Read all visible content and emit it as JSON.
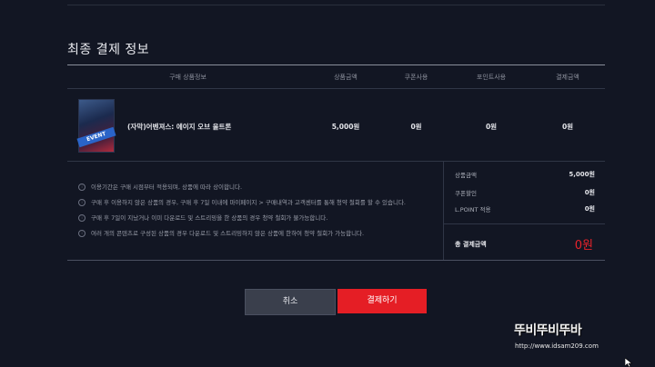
{
  "section": {
    "title": "최종 결제 정보"
  },
  "table": {
    "headers": [
      "구매 상품정보",
      "상품금액",
      "쿠폰사용",
      "포인트사용",
      "결제금액"
    ],
    "row": {
      "product_name": "(자막)어벤져스: 에이지 오브 울트론",
      "poster_badge": "EVENT",
      "price": "5,000원",
      "coupon": "0원",
      "points": "0원",
      "payment": "0원"
    }
  },
  "notes": [
    "이용기간은 구매 시점부터 적용되며, 상품에 따라 상이합니다.",
    "구매 후 이용하지 않은 상품의 경우, 구매 후 7일 이내에 마이페이지 > 구매내역과 고객센터를 통해 청약 철회를 할 수 있습니다.",
    "구매 후 7일이 지났거나 이미 다운로드 및 스트리밍을 한 상품의 경우 청약 철회가 불가능합니다.",
    "여러 개의 콘텐츠로 구성된 상품의 경우 다운로드 및 스트리밍하지 않은 상품에 한하여 청약 철회가 가능합니다."
  ],
  "summary": {
    "price_label": "상품금액",
    "price_value": "5,000원",
    "coupon_label": "쿠폰할인",
    "coupon_value": "0원",
    "point_label": "L.POINT 적용",
    "point_value": "0원",
    "total_label": "총 결제금액",
    "total_value": "0원"
  },
  "buttons": {
    "cancel": "취소",
    "pay": "결제하기"
  },
  "watermark": {
    "text": "뚜비뚜비뚜바",
    "url": "http://www.idsam209.com"
  },
  "colors": {
    "background": "#121623",
    "accent": "#e51e25",
    "total": "#e8232b"
  }
}
